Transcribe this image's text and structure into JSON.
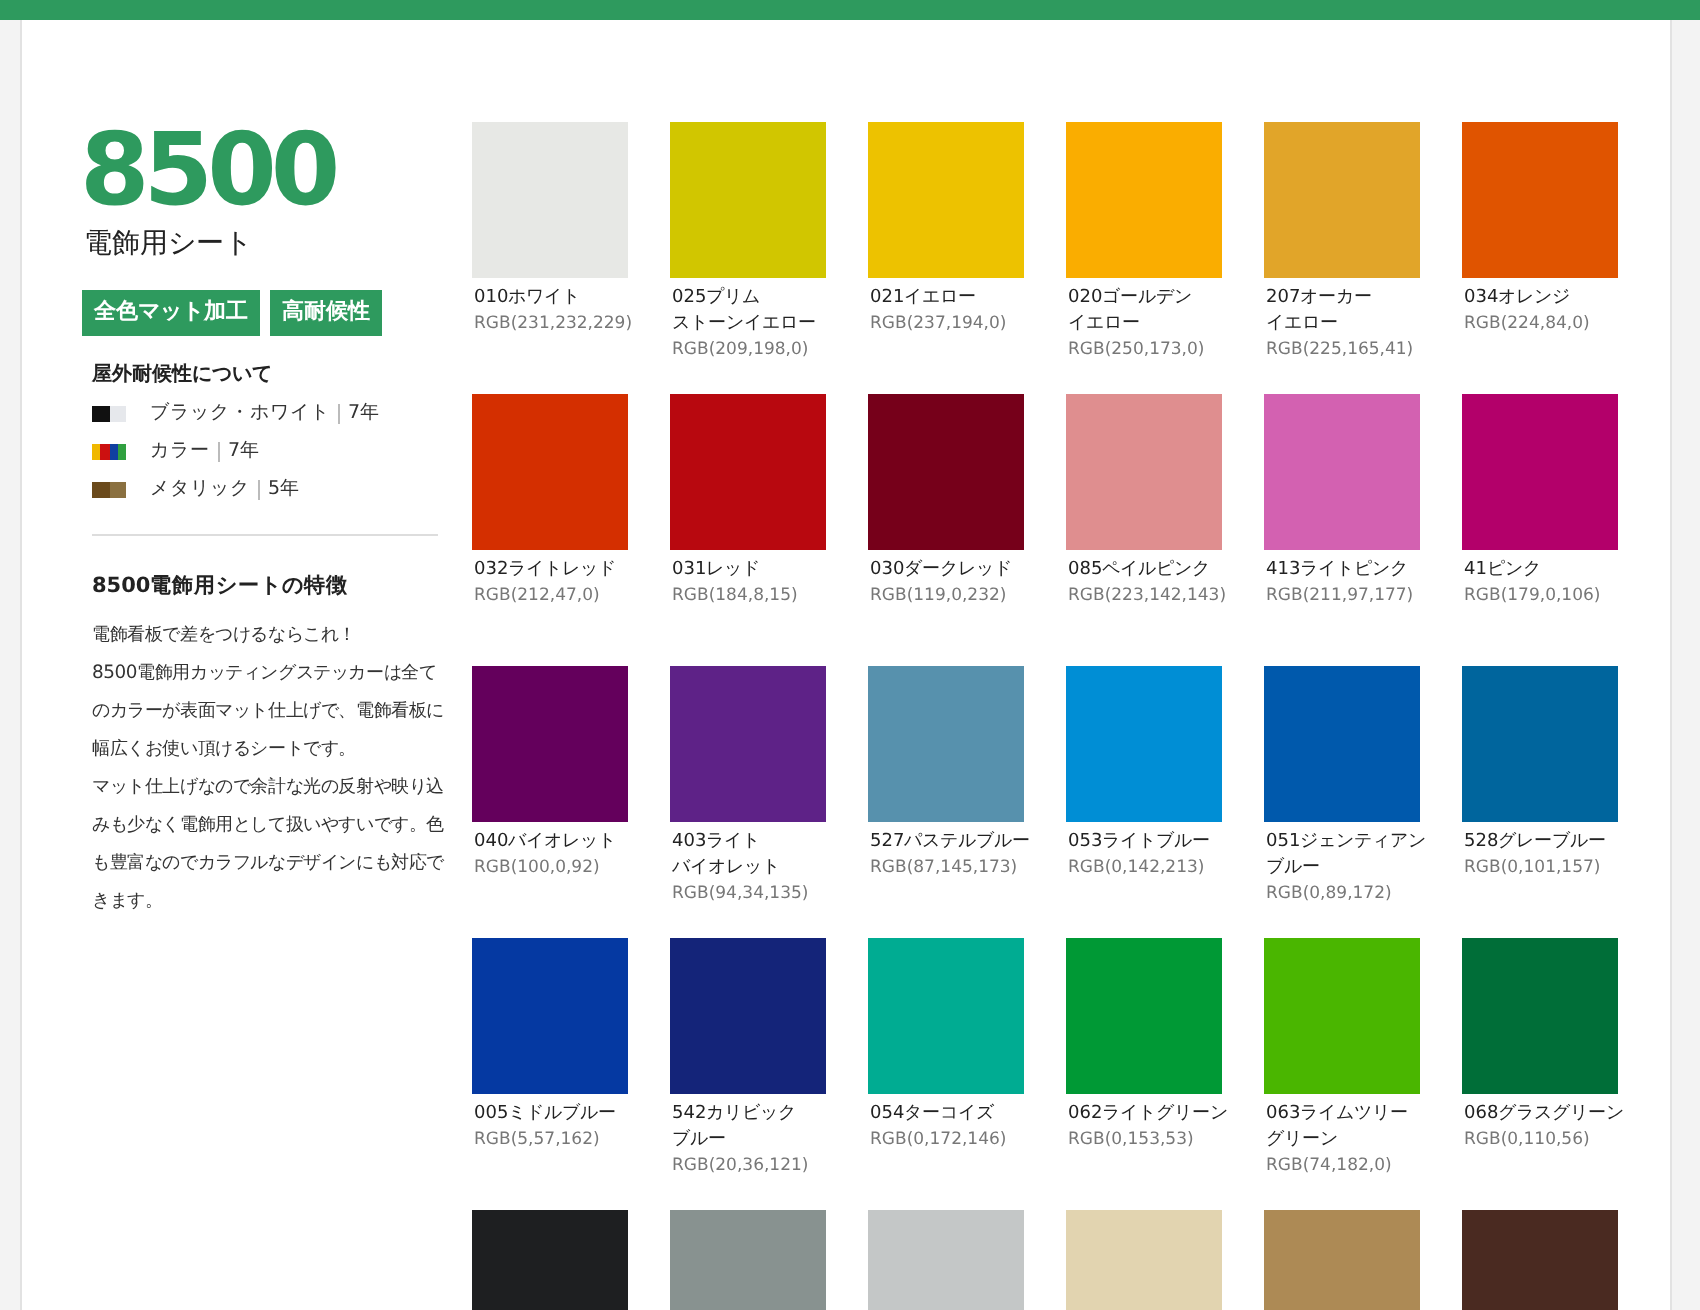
{
  "product": {
    "number": "8500",
    "subtitle": "電飾用シート",
    "badges": [
      "全色マット加工",
      "高耐候性"
    ]
  },
  "weather": {
    "title": "屋外耐候性について",
    "items": [
      {
        "kind": "mono",
        "label": "ブラック・ホワイト",
        "term": "7年"
      },
      {
        "kind": "color",
        "label": "カラー",
        "term": "7年"
      },
      {
        "kind": "metallic",
        "label": "メタリック",
        "term": "5年"
      }
    ]
  },
  "features": {
    "title": "8500電飾用シートの特徴",
    "paragraphs": [
      "電飾看板で差をつけるならこれ！",
      "8500電飾用カッティングステッカーは全てのカラーが表面マット仕上げで、電飾看板に幅広くお使い頂けるシートです。",
      "マット仕上げなので余計な光の反射や映り込みも少なく電飾用として扱いやすいです。色も豊富なのでカラフルなデザインにも対応できます。"
    ]
  },
  "swatches": [
    {
      "color": "#e7e8e5",
      "name": [
        "010ホワイト"
      ],
      "rgb": "RGB(231,232,229)"
    },
    {
      "color": "#d1c600",
      "name": [
        "025プリム",
        "ストーンイエロー"
      ],
      "rgb": "RGB(209,198,0)"
    },
    {
      "color": "#edc200",
      "name": [
        "021イエロー"
      ],
      "rgb": "RGB(237,194,0)"
    },
    {
      "color": "#faad00",
      "name": [
        "020ゴールデン",
        "イエロー"
      ],
      "rgb": "RGB(250,173,0)"
    },
    {
      "color": "#e1a529",
      "name": [
        "207オーカー",
        "イエロー"
      ],
      "rgb": "RGB(225,165,41)"
    },
    {
      "color": "#e05400",
      "name": [
        "034オレンジ"
      ],
      "rgb": "RGB(224,84,0)"
    },
    {
      "color": "#d42f00",
      "name": [
        "032ライトレッド"
      ],
      "rgb": "RGB(212,47,0)"
    },
    {
      "color": "#b8080f",
      "name": [
        "031レッド"
      ],
      "rgb": "RGB(184,8,15)"
    },
    {
      "color": "#76001a",
      "name": [
        "030ダークレッド"
      ],
      "rgb": "RGB(119,0,232)"
    },
    {
      "color": "#df8e8f",
      "name": [
        "085ペイルピンク"
      ],
      "rgb": "RGB(223,142,143)"
    },
    {
      "color": "#d361b1",
      "name": [
        "413ライトピンク"
      ],
      "rgb": "RGB(211,97,177)"
    },
    {
      "color": "#b3006a",
      "name": [
        "41ピンク"
      ],
      "rgb": "RGB(179,0,106)"
    },
    {
      "color": "#64005c",
      "name": [
        "040バイオレット"
      ],
      "rgb": "RGB(100,0,92)"
    },
    {
      "color": "#5e2287",
      "name": [
        "403ライト",
        "バイオレット"
      ],
      "rgb": "RGB(94,34,135)"
    },
    {
      "color": "#5791ad",
      "name": [
        "527パステルブルー"
      ],
      "rgb": "RGB(87,145,173)"
    },
    {
      "color": "#008ed5",
      "name": [
        "053ライトブルー"
      ],
      "rgb": "RGB(0,142,213)"
    },
    {
      "color": "#0059ac",
      "name": [
        "051ジェンティアン",
        "ブルー"
      ],
      "rgb": "RGB(0,89,172)"
    },
    {
      "color": "#00659d",
      "name": [
        "528グレーブルー"
      ],
      "rgb": "RGB(0,101,157)"
    },
    {
      "color": "#0539a2",
      "name": [
        "005ミドルブルー"
      ],
      "rgb": "RGB(5,57,162)"
    },
    {
      "color": "#142479",
      "name": [
        "542カリビック",
        "ブルー"
      ],
      "rgb": "RGB(20,36,121)"
    },
    {
      "color": "#00ac92",
      "name": [
        "054ターコイズ"
      ],
      "rgb": "RGB(0,172,146)"
    },
    {
      "color": "#009935",
      "name": [
        "062ライトグリーン"
      ],
      "rgb": "RGB(0,153,53)"
    },
    {
      "color": "#4ab600",
      "name": [
        "063ライムツリー",
        "グリーン"
      ],
      "rgb": "RGB(74,182,0)"
    },
    {
      "color": "#006e38",
      "name": [
        "068グラスグリーン"
      ],
      "rgb": "RGB(0,110,56)"
    },
    {
      "color": "#1e1f21"
    },
    {
      "color": "#889290"
    },
    {
      "color": "#c4c7c7"
    },
    {
      "color": "#e2d4b0"
    },
    {
      "color": "#ad8a55"
    },
    {
      "color": "#4a2a21"
    }
  ]
}
